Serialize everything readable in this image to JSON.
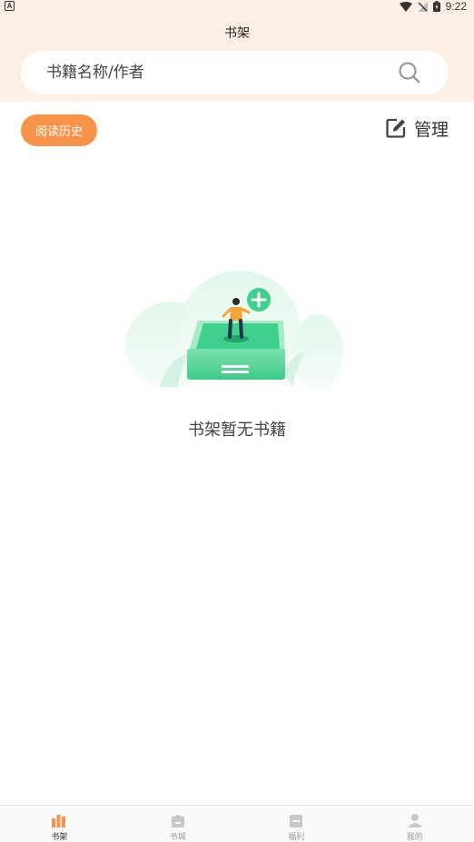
{
  "status_bar": {
    "time": "9:22",
    "left_badge": "A"
  },
  "header": {
    "title": "书架"
  },
  "search": {
    "placeholder": "书籍名称/作者"
  },
  "toolbar": {
    "history_label": "阅读历史",
    "manage_label": "管理"
  },
  "empty_state": {
    "message": "书架暂无书籍"
  },
  "bottom_nav": {
    "items": [
      {
        "label": "书架",
        "icon": "bookshelf-icon",
        "active": true
      },
      {
        "label": "书城",
        "icon": "bookstore-icon",
        "active": false
      },
      {
        "label": "福利",
        "icon": "welfare-icon",
        "active": false
      },
      {
        "label": "我的",
        "icon": "profile-icon",
        "active": false
      }
    ]
  },
  "colors": {
    "header_bg": "#fdefe4",
    "accent": "#f8944a",
    "active_nav": "#f8944a",
    "inactive_nav": "#c8c8c8",
    "illustration_green": "#3fcf8e"
  }
}
